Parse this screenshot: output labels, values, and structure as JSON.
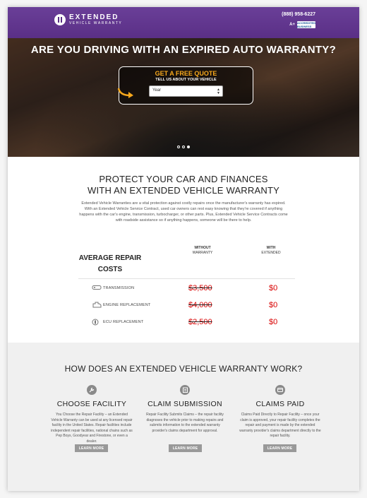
{
  "header": {
    "logo_main": "EXTENDED",
    "logo_sub": "VEHICLE WARRANTY",
    "phone": "(888) 958-6227",
    "badge_a": "A+",
    "badge_bbb": "ACCREDITED BUSINESS"
  },
  "hero": {
    "title": "ARE YOU DRIVING WITH AN EXPIRED AUTO WARRANTY?",
    "quote_title": "GET A FREE QUOTE",
    "quote_sub": "TELL US ABOUT YOUR VEHICLE",
    "year_value": "Year",
    "slides": 3,
    "active_slide": 3
  },
  "protect": {
    "title_line1": "PROTECT YOUR CAR AND FINANCES",
    "title_line2": "WITH AN EXTENDED VEHICLE WARRANTY",
    "body": "Extended Vehicle Warranties are a vital protection against costly repairs once the manufacturer's warranty has expired. With an Extended Vehicle Service Contract, used car owners can rest easy knowing that they're covered if anything happens with the car's engine, transmission, turbocharger, or other parts. Plus, Extended Vehicle Service Contracts come with roadside assistance so if anything happens, someone will be there to help."
  },
  "repair": {
    "heading_line1": "AVERAGE REPAIR",
    "heading_line2": "COSTS",
    "col_without_1": "WITHOUT",
    "col_without_2": "WARRANTY",
    "col_with_1": "WITH",
    "col_with_2": "EXTENDED",
    "rows": [
      {
        "label": "TRANSMISSION",
        "without": "$3,500",
        "with": "$0",
        "icon": "transmission-icon"
      },
      {
        "label": "ENGINE REPLACEMENT",
        "without": "$4,000",
        "with": "$0",
        "icon": "engine-icon"
      },
      {
        "label": "ECU REPLACEMENT",
        "without": "$2,500",
        "with": "$0",
        "icon": "ecu-icon"
      }
    ]
  },
  "how": {
    "title": "HOW DOES AN EXTENDED VEHICLE WARRANTY WORK?",
    "steps": [
      {
        "title": "CHOOSE FACILITY",
        "icon": "wrench-icon",
        "text": "You Choose the Repair Facility – an Extended Vehicle Warranty can be used at any licensed repair facility in the United States. Repair facilities include independent repair facilities, national chains such as Pep Boys, Goodyear and Firestone, or even a dealer.",
        "button": "LEARN MORE"
      },
      {
        "title": "CLAIM SUBMISSION",
        "icon": "clipboard-icon",
        "text": "Repair Facility Submits Claims – the repair facility diagnoses the vehicle prior to making repairs and submits information to the extended warranty provider's claims department for approval.",
        "button": "LEARN MORE"
      },
      {
        "title": "CLAIMS PAID",
        "icon": "wallet-icon",
        "text": "Claims Paid Directly to Repair Facility – once your claim is approved, your repair facility completes the repair and payment is made by the extended warranty provider's claims department directly to the repair facility.",
        "button": "LEARN MORE"
      }
    ]
  },
  "colors": {
    "header_purple": "#5a2f86",
    "quote_orange": "#f6a81c",
    "price_red": "#d80000",
    "button_gray": "#999999"
  }
}
